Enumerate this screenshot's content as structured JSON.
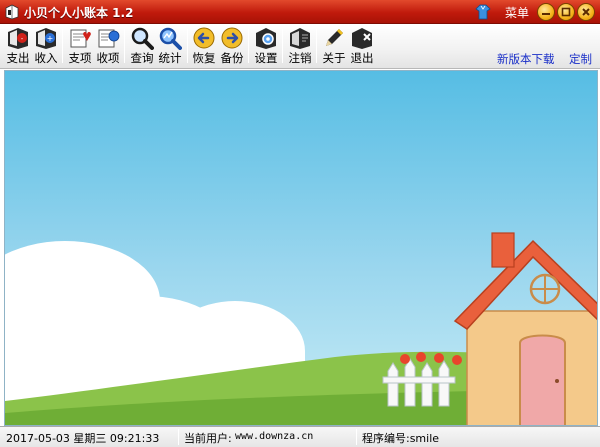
{
  "window": {
    "title": "小贝个人小账本 1.2",
    "menu_label": "菜单",
    "accent_color": "#c01a0c",
    "controls": [
      "minimize-icon",
      "maximize-icon",
      "close-icon"
    ]
  },
  "toolbar": {
    "buttons": [
      {
        "id": "expense",
        "label": "支出",
        "icon": "expense-book-icon"
      },
      {
        "id": "income",
        "label": "收入",
        "icon": "income-book-icon"
      },
      {
        "id": "expense-items",
        "label": "支项",
        "icon": "expense-items-icon"
      },
      {
        "id": "income-items",
        "label": "收项",
        "icon": "income-items-icon"
      },
      {
        "id": "query",
        "label": "查询",
        "icon": "magnifier-icon"
      },
      {
        "id": "stats",
        "label": "统计",
        "icon": "stats-magnifier-icon"
      },
      {
        "id": "restore",
        "label": "恢复",
        "icon": "left-arrow-icon"
      },
      {
        "id": "backup",
        "label": "备份",
        "icon": "right-arrow-icon"
      },
      {
        "id": "settings",
        "label": "设置",
        "icon": "settings-icon"
      },
      {
        "id": "logout",
        "label": "注销",
        "icon": "logout-book-icon"
      },
      {
        "id": "about",
        "label": "关于",
        "icon": "pen-icon"
      },
      {
        "id": "exit",
        "label": "退出",
        "icon": "exit-book-icon"
      }
    ],
    "links": {
      "download": "新版本下载",
      "customize": "定制"
    },
    "link_color": "#1a2fc8"
  },
  "status": {
    "datetime": "2017-05-03 星期三 09:21:33",
    "user_label": "当前用户:",
    "user_value": "www.downza.cn",
    "program_label": "程序编号:smile"
  }
}
